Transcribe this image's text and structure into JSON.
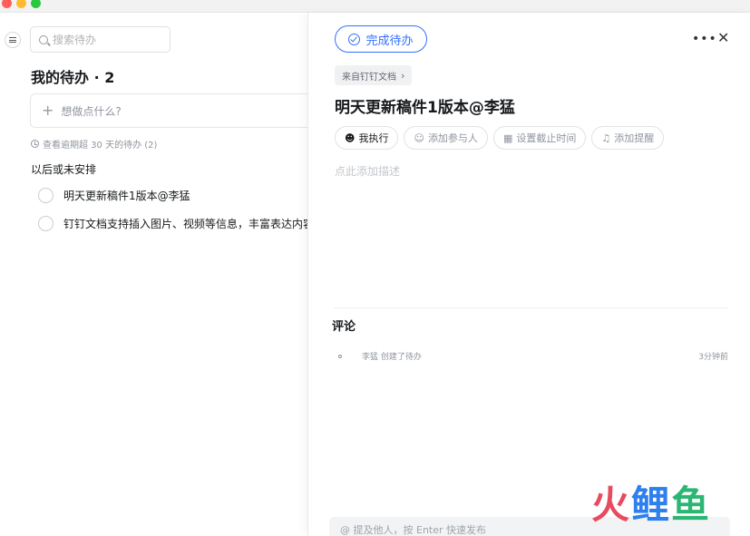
{
  "window": {
    "controls": [
      "close",
      "minimize",
      "zoom"
    ]
  },
  "left": {
    "search_placeholder": "搜索待办",
    "list_title": "我的待办 · 2",
    "add_placeholder": "想做点什么?",
    "overdue_link": "查看逾期超 30 天的待办 (2)",
    "section_label": "以后或未安排",
    "todos": [
      {
        "text": "明天更新稿件1版本@李猛"
      },
      {
        "text": "钉钉文档支持插入图片、视频等信息，丰富表达内容，"
      }
    ]
  },
  "detail": {
    "complete_label": "完成待办",
    "source_tag": "来自钉钉文档",
    "title": "明天更新稿件1版本@李猛",
    "chips": {
      "assignee": "我执行",
      "participants": "添加参与人",
      "due": "设置截止时间",
      "reminder": "添加提醒"
    },
    "description_placeholder": "点此添加描述",
    "comments_title": "评论",
    "activity": {
      "text": "李猛 创建了待办",
      "time": "3分钟前"
    },
    "comment_placeholder": "@ 提及他人，按 Enter 快速发布"
  },
  "watermark": {
    "c1": "火",
    "c2": "鲤",
    "c3": "鱼"
  },
  "colors": {
    "accent": "#3370ff",
    "text": "#171a1d",
    "muted": "#8f959e"
  }
}
